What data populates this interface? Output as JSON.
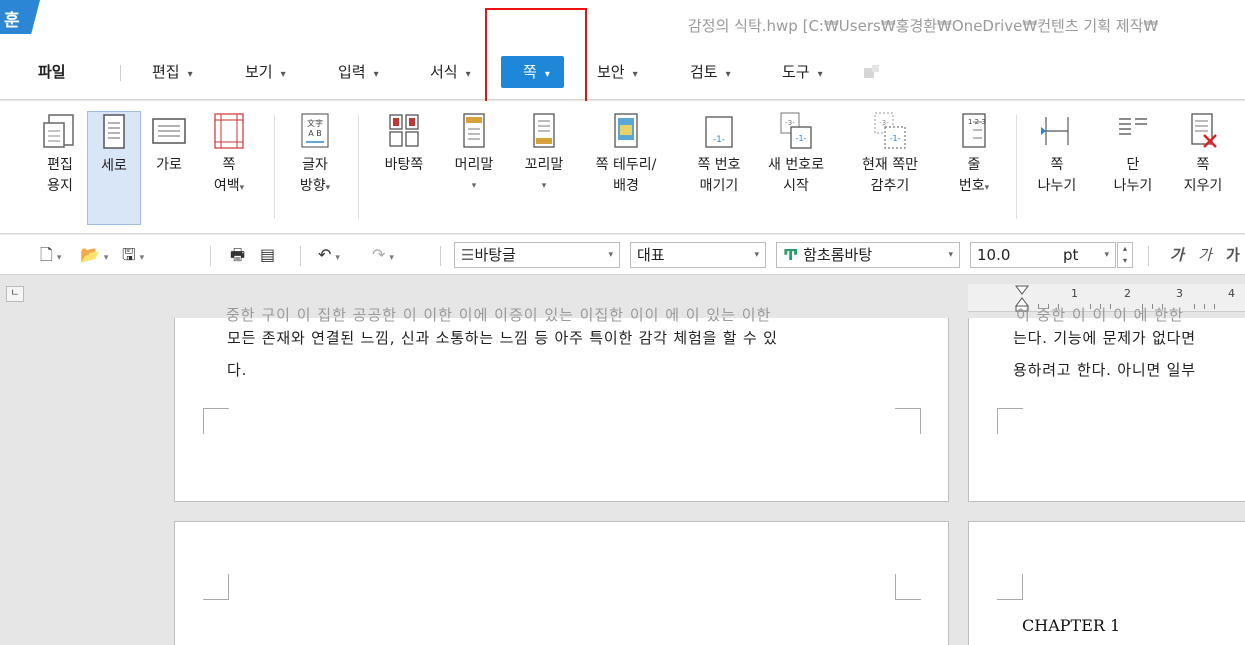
{
  "window": {
    "logo": "훈",
    "title": "감정의 식탁.hwp [C:₩Users₩홍경환₩OneDrive₩컨텐츠 기획 제작₩"
  },
  "menu": {
    "file": "파일",
    "items": [
      {
        "label": "편집"
      },
      {
        "label": "보기"
      },
      {
        "label": "입력"
      },
      {
        "label": "서식"
      },
      {
        "label": "쪽"
      },
      {
        "label": "보안"
      },
      {
        "label": "검토"
      },
      {
        "label": "도구"
      }
    ],
    "active": "쪽"
  },
  "ribbon": {
    "buttons": [
      {
        "line1": "편집",
        "line2": "용지",
        "icon": "edit-paper-icon"
      },
      {
        "line1": "세로",
        "line2": "",
        "icon": "portrait-icon"
      },
      {
        "line1": "가로",
        "line2": "",
        "icon": "landscape-icon"
      },
      {
        "line1": "쪽",
        "line2": "여백",
        "icon": "page-margin-icon"
      },
      {
        "line1": "글자",
        "line2": "방향",
        "icon": "text-direction-icon"
      },
      {
        "line1": "바탕쪽",
        "line2": "",
        "icon": "master-page-icon"
      },
      {
        "line1": "머리말",
        "line2": "",
        "icon": "header-icon"
      },
      {
        "line1": "꼬리말",
        "line2": "",
        "icon": "footer-icon"
      },
      {
        "line1": "쪽 테두리/",
        "line2": "배경",
        "icon": "page-border-icon"
      },
      {
        "line1": "쪽 번호",
        "line2": "매기기",
        "icon": "page-number-icon"
      },
      {
        "line1": "새 번호로",
        "line2": "시작",
        "icon": "new-number-icon"
      },
      {
        "line1": "현재 쪽만",
        "line2": "감추기",
        "icon": "hide-page-icon"
      },
      {
        "line1": "줄",
        "line2": "번호",
        "icon": "line-number-icon"
      },
      {
        "line1": "쪽",
        "line2": "나누기",
        "icon": "page-break-icon"
      },
      {
        "line1": "단",
        "line2": "나누기",
        "icon": "column-break-icon"
      },
      {
        "line1": "쪽",
        "line2": "지우기",
        "icon": "delete-page-icon"
      }
    ],
    "icon_texts": {
      "text_dir_top": "文字",
      "text_dir_bottom": "A B",
      "page_num": "-1-",
      "new_num_top": "-3-",
      "new_num_bottom": "-1-",
      "hide_top": "-3-",
      "hide_bottom": "-1-",
      "line_num": "1 2 3"
    }
  },
  "toolbar": {
    "style": "바탕글",
    "lang": "대표",
    "font": "함초롬바탕",
    "font_icon": "Ͳ",
    "size": "10.0",
    "unit": "pt",
    "fmt1": "가",
    "fmt2": "가",
    "fmt3": "가"
  },
  "ruler": {
    "n1": "1",
    "n2": "2",
    "n3": "3",
    "n4": "4",
    "corner": "ㄴ"
  },
  "pages": {
    "left_cut": "중한 구이  이 집한 공공한 이  이한 이에 이증이 있는 이집한 이이 에 이 있는 이한",
    "left_line1": "모든 존재와 연결된 느낌, 신과 소통하는 느낌 등 아주 특이한 감각 체험을 할 수 있",
    "left_line2": "다.",
    "right_cut": "이 중한 이  이  이 에  한한",
    "right_line1": "는다. 기능에 문제가 없다면",
    "right_line2": "용하려고 한다. 아니면 일부",
    "chapter": "CHAPTER 1"
  },
  "colors": {
    "accent": "#1f87d8",
    "highlight": "#ee1111",
    "selected": "#d9e6f7"
  }
}
